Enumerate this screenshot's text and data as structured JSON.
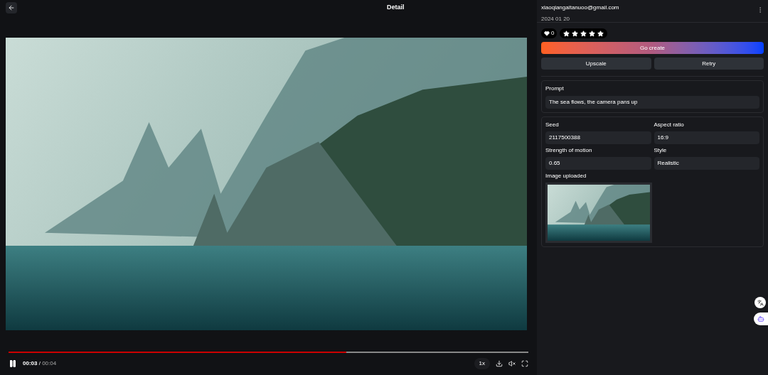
{
  "header": {
    "title": "Detail"
  },
  "player": {
    "progress": {
      "level": 0.65
    },
    "current_time": "00:03",
    "separator": "/",
    "duration": "00:04",
    "speed": "1x",
    "playing": true,
    "muted": true
  },
  "author": {
    "email": "xiaoqiangaitanuoo@gmail.com",
    "date": "2024 01 20"
  },
  "likes": {
    "count": "0",
    "liked": true
  },
  "rating": {
    "stars": 5
  },
  "actions": {
    "primary": "Go create",
    "secondary": [
      "Upscale",
      "Retry"
    ]
  },
  "prompt": {
    "label": "Prompt",
    "value": "The sea flows, the camera pans up"
  },
  "params": [
    {
      "label": "Seed",
      "value": "2117500388"
    },
    {
      "label": "Aspect ratio",
      "value": "16:9"
    },
    {
      "label": "Strength of motion",
      "value": "0.65"
    },
    {
      "label": "Style",
      "value": "Realistic"
    }
  ],
  "image_uploaded": {
    "label": "Image uploaded"
  }
}
